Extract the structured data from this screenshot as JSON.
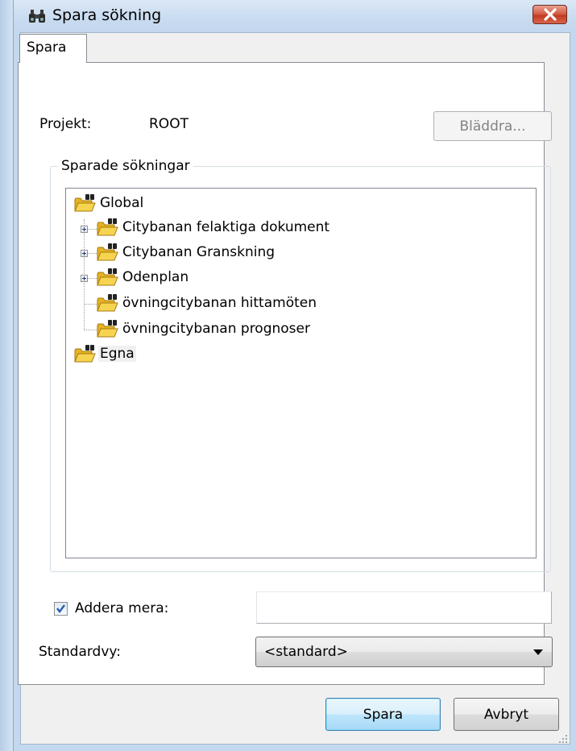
{
  "window": {
    "title": "Spara sökning",
    "icon": "binoculars-icon"
  },
  "tabs": [
    {
      "label": "Spara"
    }
  ],
  "project": {
    "label": "Projekt:",
    "value": "ROOT",
    "browse_label": "Bläddra..."
  },
  "saved_searches": {
    "legend": "Sparade sökningar",
    "tree": [
      {
        "label": "Global",
        "icon": "search-folder-icon",
        "expanded": true
      },
      {
        "label": "Citybanan felaktiga dokument",
        "icon": "search-folder-icon",
        "has_children": true
      },
      {
        "label": "Citybanan Granskning",
        "icon": "search-folder-icon",
        "has_children": true
      },
      {
        "label": "Odenplan",
        "icon": "search-folder-icon",
        "has_children": true
      },
      {
        "label": "övningcitybanan hittamöten",
        "icon": "search-folder-icon",
        "has_children": false
      },
      {
        "label": "övningcitybanan prognoser",
        "icon": "search-folder-icon",
        "has_children": false
      },
      {
        "label": "Egna",
        "icon": "search-folder-icon",
        "selected": true
      }
    ]
  },
  "add_more": {
    "label": "Addera mera:",
    "checked": true,
    "value": ""
  },
  "default_view": {
    "label": "Standardvy:",
    "selected": "<standard>"
  },
  "buttons": {
    "save": "Spara",
    "cancel": "Avbryt"
  },
  "colors": {
    "close_button": "#c13a20",
    "title_bar": "#c8dbf0",
    "dialog_bg": "#f0f0f0",
    "checkbox_check": "#2a5db0"
  }
}
